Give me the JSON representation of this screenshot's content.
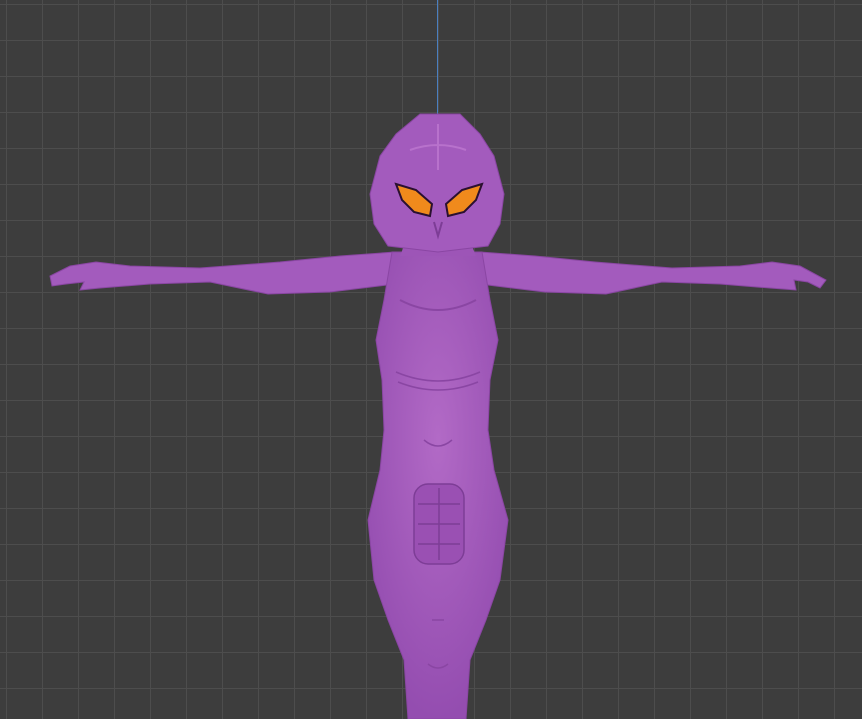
{
  "viewport": {
    "background": "#3d3d3d",
    "grid_color": "#4d4d4d",
    "axis_color": "#4a7fc0"
  },
  "model": {
    "body_color": "#a35bbd",
    "shade_color": "#8a46a3",
    "light_color": "#b872cc",
    "eye_color": "#f08a1c",
    "eye_outline": "#2a1030"
  }
}
